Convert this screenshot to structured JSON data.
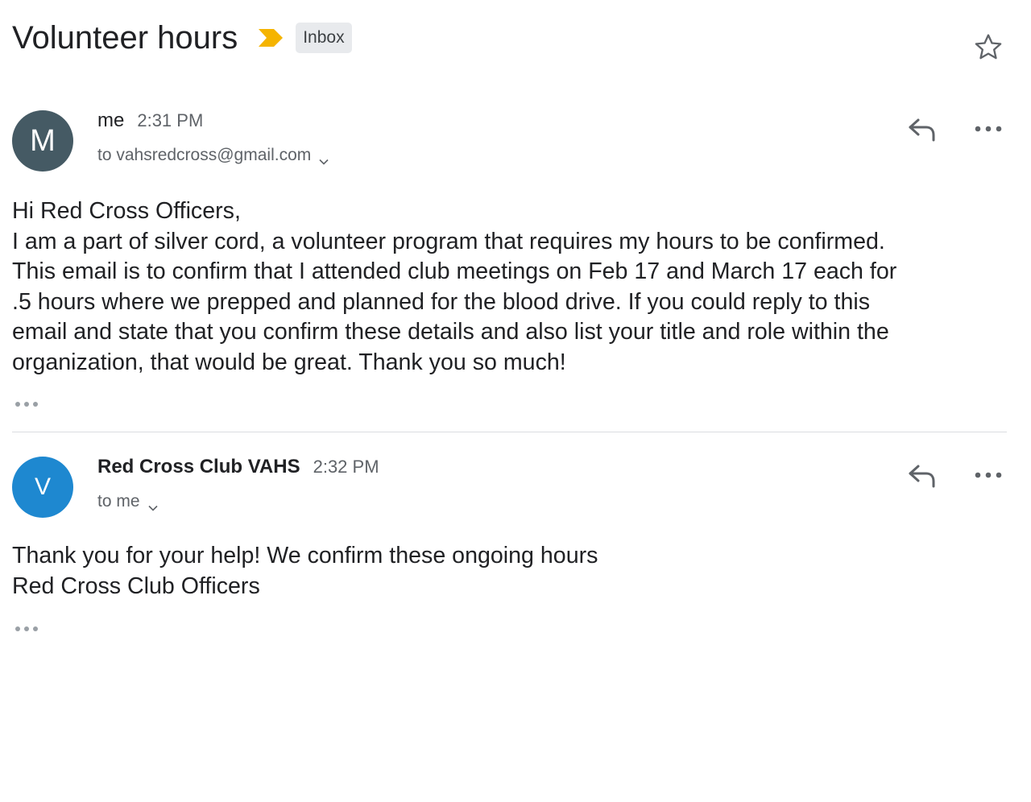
{
  "thread": {
    "subject": "Volunteer hours",
    "label": "Inbox",
    "importance_icon": "importance-marker-icon",
    "importance_color": "#f5b400",
    "star_icon": "star-outline-icon"
  },
  "messages": [
    {
      "avatar_letter": "M",
      "avatar_color": "#455a64",
      "sender": "me",
      "time": "2:31 PM",
      "recipient": "to vahsredcross@gmail.com",
      "body_lines": [
        "Hi Red Cross Officers,",
        "I am a part of silver cord, a volunteer program that requires my hours to be confirmed.",
        "This email is to confirm that I attended club meetings on Feb 17 and March 17 each for",
        ".5 hours where we prepped and planned for the blood drive. If you could reply to this",
        "email and state that you confirm these details and also list your title and role within the",
        "organization, that would be great. Thank you so much!"
      ]
    },
    {
      "avatar_letter": "V",
      "avatar_color": "#1e88d0",
      "sender": "Red Cross Club VAHS",
      "time": "2:32 PM",
      "recipient": "to me",
      "body_lines": [
        "Thank you for your help! We confirm these ongoing hours",
        "Red Cross Club Officers"
      ]
    }
  ],
  "icons": {
    "reply": "reply-icon",
    "more": "more-horizontal-icon",
    "expand": "chevron-down-icon",
    "quoted": "show-trimmed-content-icon"
  }
}
